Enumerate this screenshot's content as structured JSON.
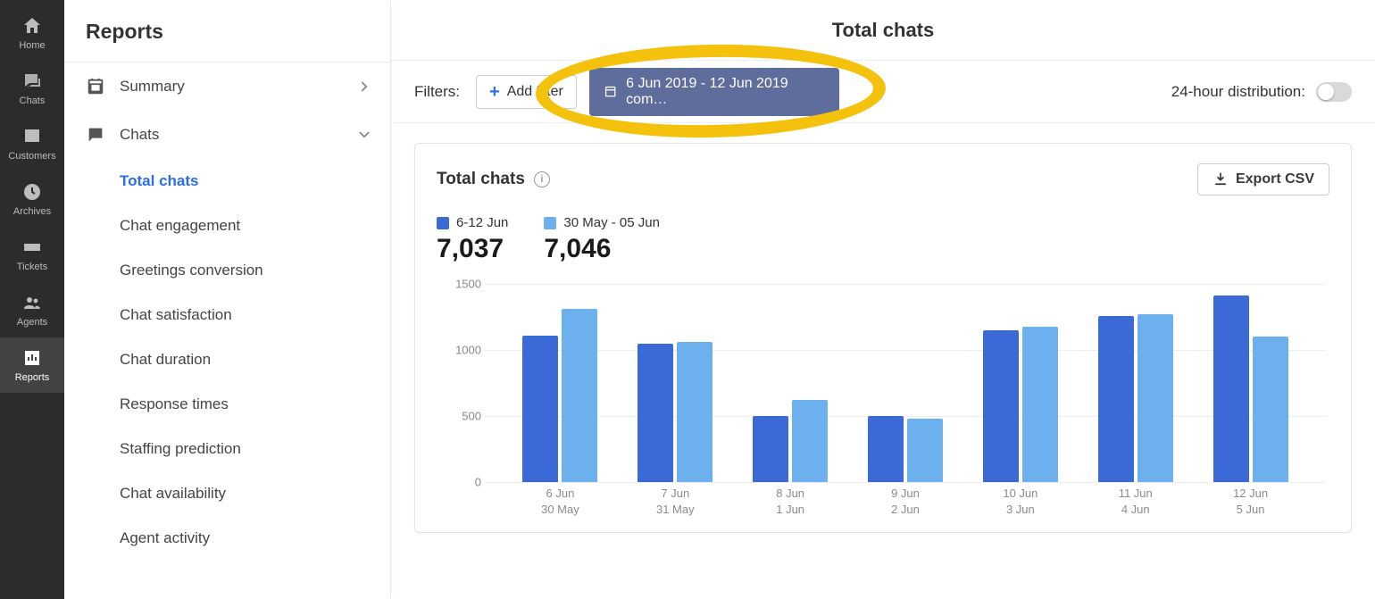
{
  "colors": {
    "seriesA": "#3b69d6",
    "seriesB": "#6cb0ed",
    "annotation": "#f4c20d",
    "chip": "#5e6d9b"
  },
  "rail": [
    {
      "id": "home",
      "label": "Home"
    },
    {
      "id": "chats",
      "label": "Chats"
    },
    {
      "id": "customers",
      "label": "Customers"
    },
    {
      "id": "archives",
      "label": "Archives"
    },
    {
      "id": "tickets",
      "label": "Tickets"
    },
    {
      "id": "agents",
      "label": "Agents"
    },
    {
      "id": "reports",
      "label": "Reports",
      "active": true
    }
  ],
  "sidebar": {
    "title": "Reports",
    "summary_label": "Summary",
    "chats_label": "Chats",
    "items": [
      "Total chats",
      "Chat engagement",
      "Greetings conversion",
      "Chat satisfaction",
      "Chat duration",
      "Response times",
      "Staffing prediction",
      "Chat availability",
      "Agent activity"
    ],
    "active_index": 0
  },
  "header": {
    "title": "Total chats"
  },
  "filters": {
    "label": "Filters:",
    "add_label": "Add filter",
    "date_chip": "6 Jun 2019 - 12 Jun 2019 com…",
    "distribution_label": "24-hour distribution:",
    "distribution_on": false
  },
  "card": {
    "title": "Total chats",
    "export_label": "Export CSV",
    "legend": [
      {
        "label": "6-12 Jun",
        "value": "7,037",
        "color": "#3b69d6"
      },
      {
        "label": "30 May - 05 Jun",
        "value": "7,046",
        "color": "#6cb0ed"
      }
    ]
  },
  "chart_data": {
    "type": "bar",
    "ylim": [
      0,
      1500
    ],
    "yticks": [
      0,
      500,
      1000,
      1500
    ],
    "xlabel": "",
    "ylabel": "",
    "categories": [
      "6 Jun",
      "7 Jun",
      "8 Jun",
      "9 Jun",
      "10 Jun",
      "11 Jun",
      "12 Jun"
    ],
    "categories2": [
      "30 May",
      "31 May",
      "1 Jun",
      "2 Jun",
      "3 Jun",
      "4 Jun",
      "5 Jun"
    ],
    "series": [
      {
        "name": "6-12 Jun",
        "color": "#3b69d6",
        "values": [
          1110,
          1050,
          500,
          500,
          1150,
          1260,
          1410
        ]
      },
      {
        "name": "30 May - 05 Jun",
        "color": "#6cb0ed",
        "values": [
          1310,
          1060,
          620,
          480,
          1175,
          1270,
          1100
        ]
      }
    ]
  }
}
